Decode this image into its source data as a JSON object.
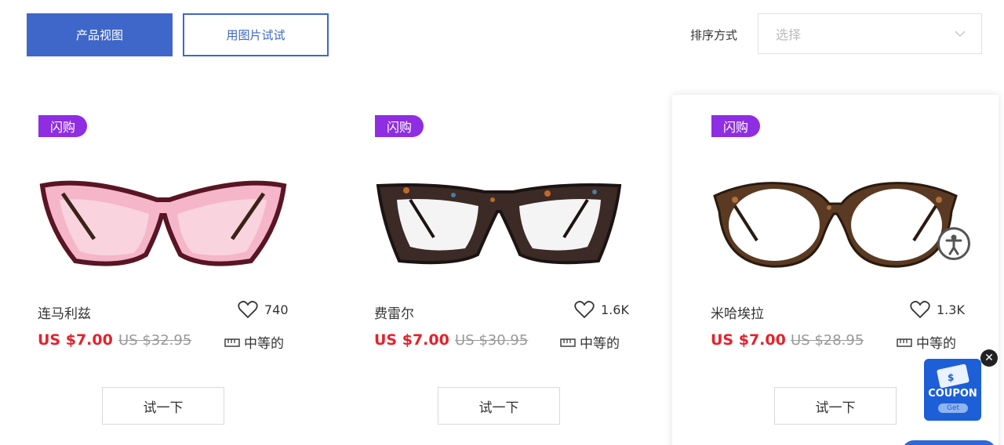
{
  "toolbar": {
    "product_view_label": "产品视图",
    "try_with_photo_label": "用图片试试",
    "sort_label": "排序方式",
    "sort_placeholder": "选择"
  },
  "products": [
    {
      "badge": "闪购",
      "name": "连马利兹",
      "likes": "740",
      "price": "US $7.00",
      "old_price": "US $32.95",
      "size": "中等的",
      "try_label": "试一下",
      "frame_color": "#f4b6c8",
      "rim_color": "#5a1525"
    },
    {
      "badge": "闪购",
      "name": "费雷尔",
      "likes": "1.6K",
      "price": "US $7.00",
      "old_price": "US $30.95",
      "size": "中等的",
      "try_label": "试一下",
      "frame_color": "#3b2a25",
      "rim_color": "#1b1412"
    },
    {
      "badge": "闪购",
      "name": "米哈埃拉",
      "likes": "1.3K",
      "price": "US $7.00",
      "old_price": "US $28.95",
      "size": "中等的",
      "try_label": "试一下",
      "frame_color": "#5a3a22",
      "rim_color": "#2a1a10"
    }
  ],
  "coupon": {
    "label": "COUPON",
    "get_label": "Get",
    "close_glyph": "✕"
  },
  "colors": {
    "accent": "#3f67c9",
    "badge": "#8e2de2",
    "price": "#e8202a"
  }
}
